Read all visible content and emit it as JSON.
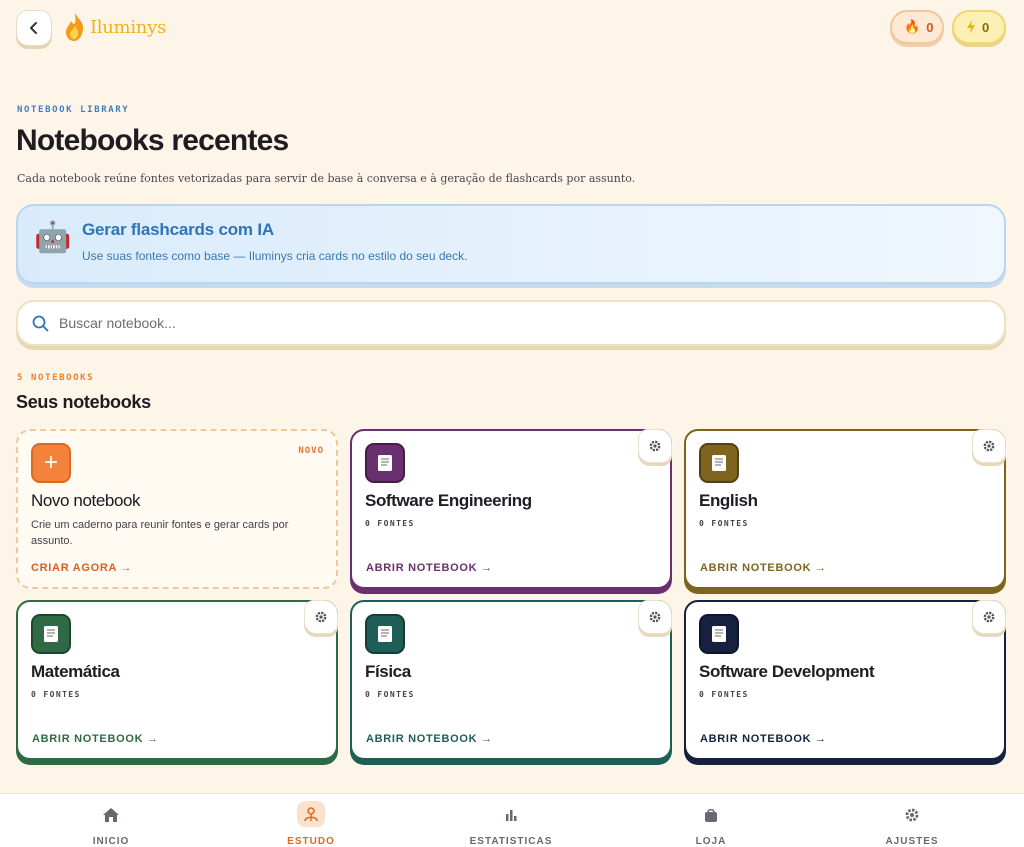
{
  "header": {
    "back_label": "Voltar",
    "logo_text": "Iluminys",
    "streak_count": "0",
    "energy_count": "0"
  },
  "intro": {
    "eyebrow": "NOTEBOOK LIBRARY",
    "title": "Notebooks recentes",
    "description": "Cada notebook reúne fontes vetorizadas para servir de base à conversa e à geração de flashcards por assunto."
  },
  "ai_banner": {
    "icon": "robot-icon",
    "title": "Gerar flashcards com IA",
    "subtitle": "Use suas fontes como base — Iluminys cria cards no estilo do seu deck."
  },
  "search": {
    "placeholder": "Buscar notebook..."
  },
  "notebooks_section": {
    "count_label": "5 NOTEBOOKS",
    "title": "Seus notebooks"
  },
  "new_notebook": {
    "badge": "NOVO",
    "title": "Novo notebook",
    "description": "Crie um caderno para reunir fontes e gerar cards por assunto.",
    "action": "CRIAR AGORA →"
  },
  "notebooks": [
    {
      "title": "Software Engineering",
      "meta": "0 FONTES",
      "action": "ABRIR NOTEBOOK →",
      "color": "#6a2f6e"
    },
    {
      "title": "English",
      "meta": "0 FONTES",
      "action": "ABRIR NOTEBOOK →",
      "color": "#7f6420"
    },
    {
      "title": "Matemática",
      "meta": "0 FONTES",
      "action": "ABRIR NOTEBOOK →",
      "color": "#2f6a44"
    },
    {
      "title": "Física",
      "meta": "0 FONTES",
      "action": "ABRIR NOTEBOOK →",
      "color": "#1f5e57"
    },
    {
      "title": "Software Development",
      "meta": "0 FONTES",
      "action": "ABRIR NOTEBOOK →",
      "color": "#15213f"
    }
  ],
  "bottom_nav": [
    {
      "label": "INICIO",
      "icon": "home-icon",
      "active": false
    },
    {
      "label": "ESTUDO",
      "icon": "study-icon",
      "active": true
    },
    {
      "label": "ESTATISTICAS",
      "icon": "stats-icon",
      "active": false
    },
    {
      "label": "LOJA",
      "icon": "shop-icon",
      "active": false
    },
    {
      "label": "AJUSTES",
      "icon": "settings-icon",
      "active": false
    }
  ],
  "colors": {
    "background": "#fdf5e7",
    "accent_orange": "#e0691d",
    "accent_blue": "#2f74b8"
  }
}
